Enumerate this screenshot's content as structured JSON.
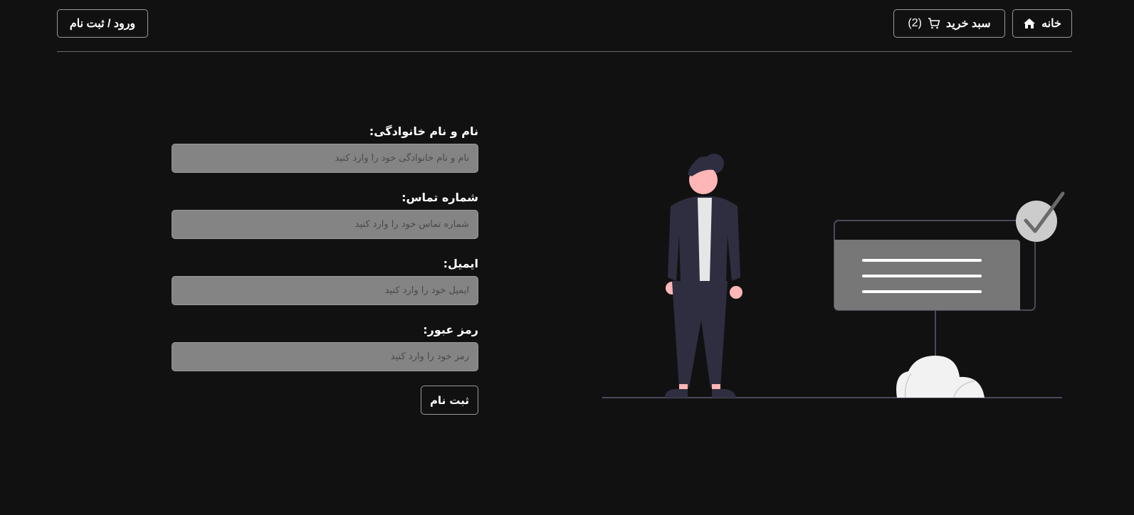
{
  "header": {
    "home_label": "خانه",
    "cart_label": "سبد خرید",
    "cart_count": "(2)",
    "login_label": "ورود / ثبت نام"
  },
  "form": {
    "name_label": "نام و نام خانوادگی:",
    "name_placeholder": "نام و نام خانوادگی خود را وارد کنید",
    "phone_label": "شماره تماس:",
    "phone_placeholder": "شماره تماس خود را وارد کنید",
    "email_label": "ایمیل:",
    "email_placeholder": "ایمیل خود را وارد کنید",
    "password_label": "رمز عبور:",
    "password_placeholder": "رمز خود را وارد کنید",
    "submit_label": "ثبت نام"
  },
  "icons": {
    "home": "home-icon",
    "cart": "cart-icon"
  },
  "colors": {
    "background": "#111111",
    "input_background": "#848484",
    "border": "#9a9a9a",
    "text": "#ffffff"
  }
}
